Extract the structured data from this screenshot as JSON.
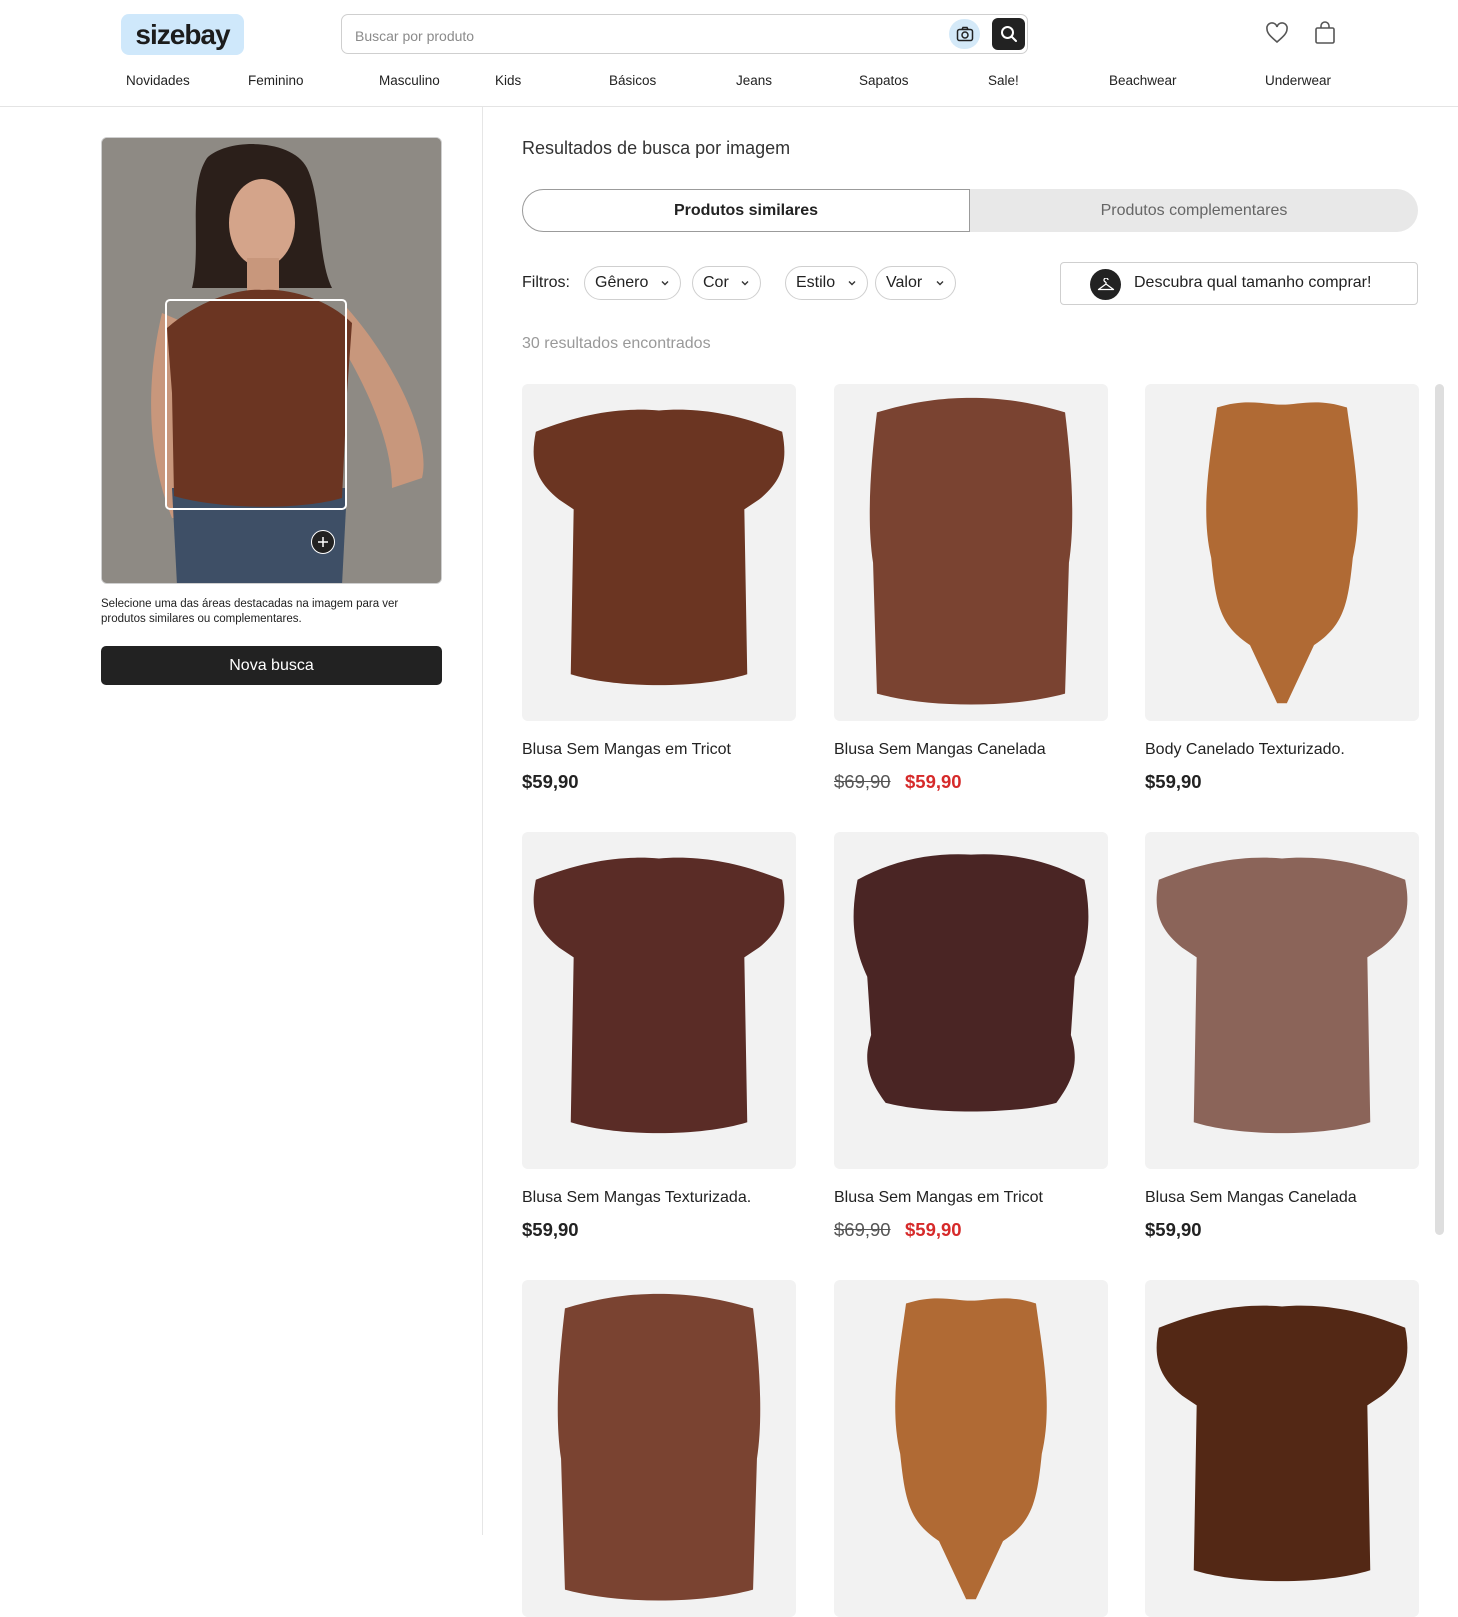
{
  "header": {
    "logo": "sizebay",
    "search_placeholder": "Buscar por produto",
    "icons": [
      "camera-icon",
      "search-icon",
      "heart-icon",
      "bag-icon"
    ],
    "nav": [
      "Novidades",
      "Feminino",
      "Masculino",
      "Kids",
      "Básicos",
      "Jeans",
      "Sapatos",
      "Sale!",
      "Beachwear",
      "Underwear"
    ]
  },
  "left": {
    "hint": "Selecione uma das áreas destacadas na imagem para ver produtos similares ou complementares.",
    "new_search": "Nova busca"
  },
  "results": {
    "title": "Resultados de busca por imagem",
    "tabs": [
      "Produtos similares",
      "Produtos complementares"
    ],
    "active_tab": "Produtos similares",
    "filters_label": "Filtros:",
    "filters": [
      "Gênero",
      "Cor",
      "Estilo",
      "Valor"
    ],
    "size_button": "Descubra qual tamanho comprar!",
    "count": "30 resultados encontrados",
    "products": [
      {
        "name": "Blusa Sem Mangas em Tricot",
        "price": "$59,90",
        "old_price": null,
        "color": "#6b3522",
        "shape": "tee"
      },
      {
        "name": "Blusa Sem Mangas Canelada",
        "price": "$59,90",
        "old_price": "$69,90",
        "color": "#7a4331",
        "shape": "tank"
      },
      {
        "name": "Body Canelado Texturizado.",
        "price": "$59,90",
        "old_price": null,
        "color": "#b06a34",
        "shape": "body"
      },
      {
        "name": "Blusa Sem Mangas Texturizada.",
        "price": "$59,90",
        "old_price": null,
        "color": "#5a2c26",
        "shape": "tee"
      },
      {
        "name": "Blusa Sem Mangas em Tricot",
        "price": "$59,90",
        "old_price": "$69,90",
        "color": "#4a2524",
        "shape": "crop"
      },
      {
        "name": "Blusa Sem Mangas Canelada",
        "price": "$59,90",
        "old_price": null,
        "color": "#8b6459",
        "shape": "tee"
      },
      {
        "name": "",
        "price": "",
        "old_price": null,
        "color": "#7a4331",
        "shape": "tank"
      },
      {
        "name": "",
        "price": "",
        "old_price": null,
        "color": "#b06a34",
        "shape": "body"
      },
      {
        "name": "",
        "price": "",
        "old_price": null,
        "color": "#532815",
        "shape": "tee"
      }
    ]
  },
  "colors": {
    "accent": "#222222",
    "sale": "#d62a2a",
    "logo_bg": "#cfe8fb"
  }
}
